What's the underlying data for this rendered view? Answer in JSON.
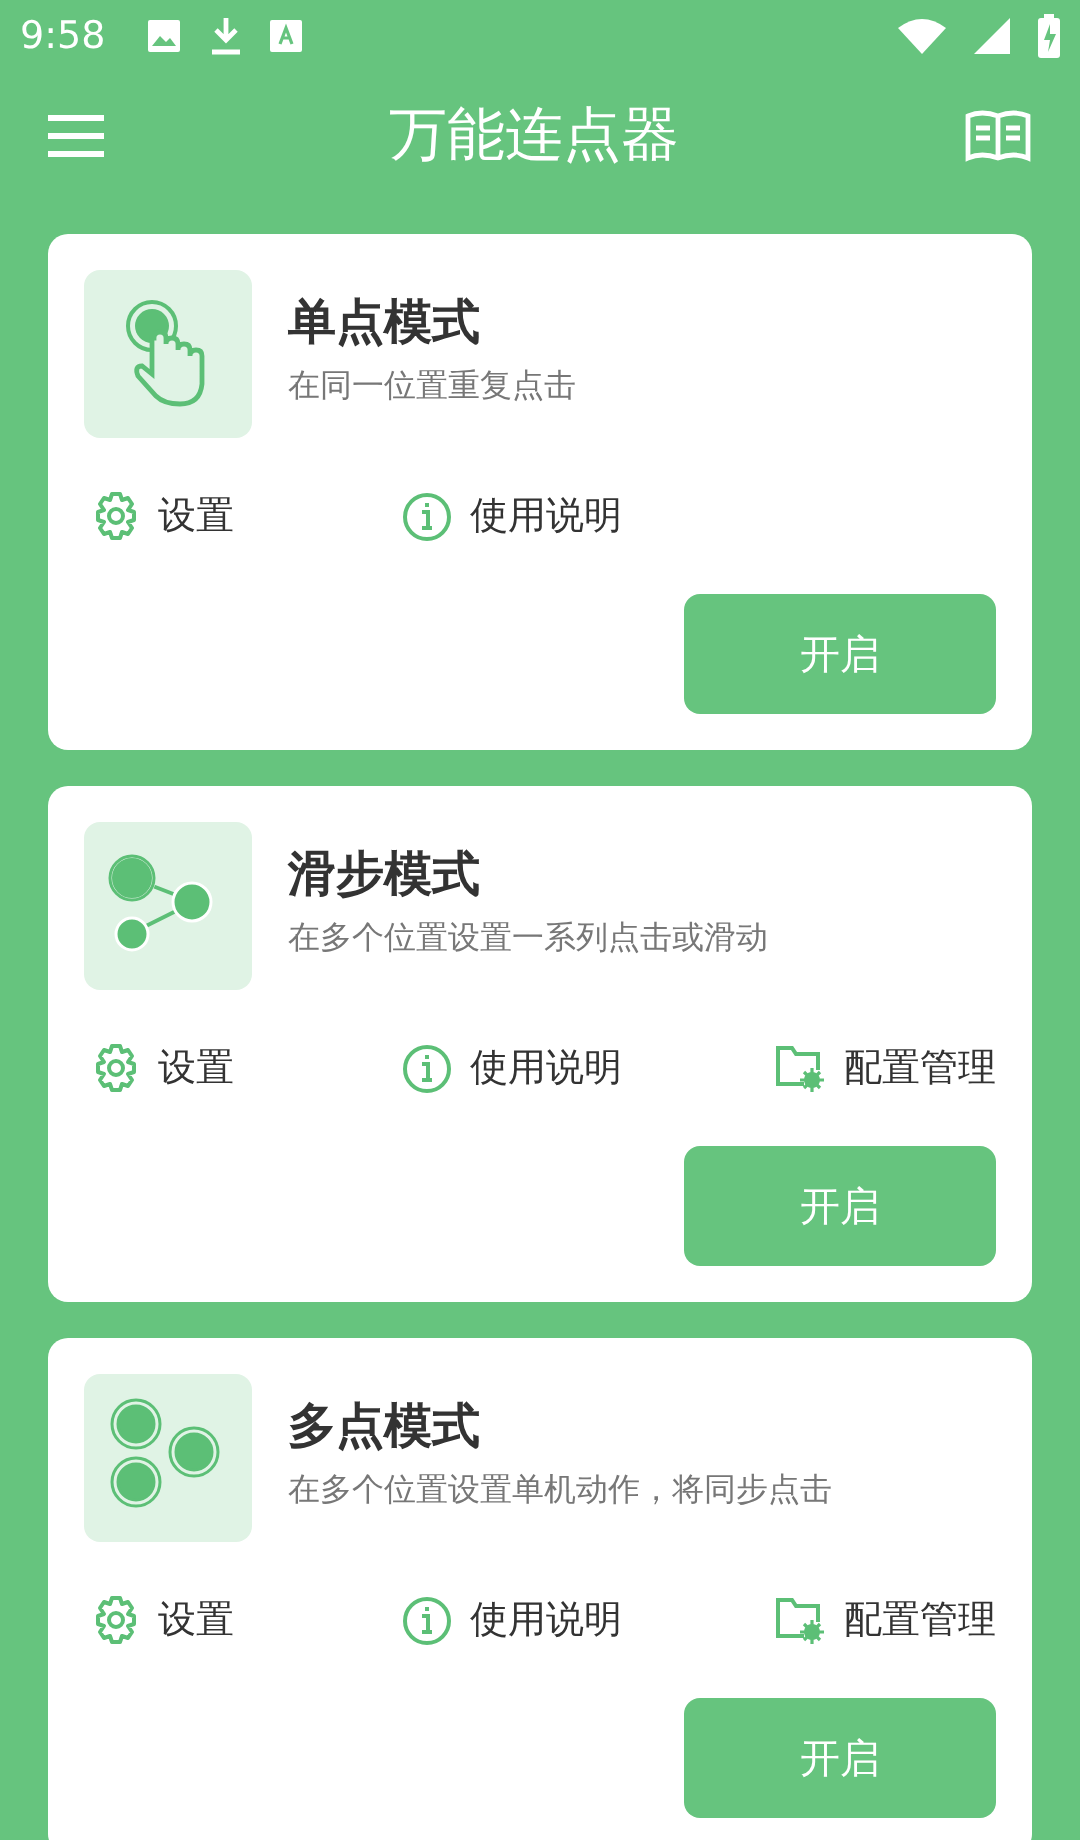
{
  "status_bar": {
    "time": "9:58"
  },
  "app_bar": {
    "title": "万能连点器"
  },
  "modes": [
    {
      "kind": "single",
      "title": "单点模式",
      "description": "在同一位置重复点击",
      "actions": [
        {
          "kind": "settings",
          "label": "设置"
        },
        {
          "kind": "help",
          "label": "使用说明"
        }
      ],
      "button": "开启"
    },
    {
      "kind": "swipe",
      "title": "滑步模式",
      "description": "在多个位置设置一系列点击或滑动",
      "actions": [
        {
          "kind": "settings",
          "label": "设置"
        },
        {
          "kind": "help",
          "label": "使用说明"
        },
        {
          "kind": "config",
          "label": "配置管理"
        }
      ],
      "button": "开启"
    },
    {
      "kind": "multi",
      "title": "多点模式",
      "description": "在多个位置设置单机动作，将同步点击",
      "actions": [
        {
          "kind": "settings",
          "label": "设置"
        },
        {
          "kind": "help",
          "label": "使用说明"
        },
        {
          "kind": "config",
          "label": "配置管理"
        }
      ],
      "button": "开启"
    }
  ]
}
